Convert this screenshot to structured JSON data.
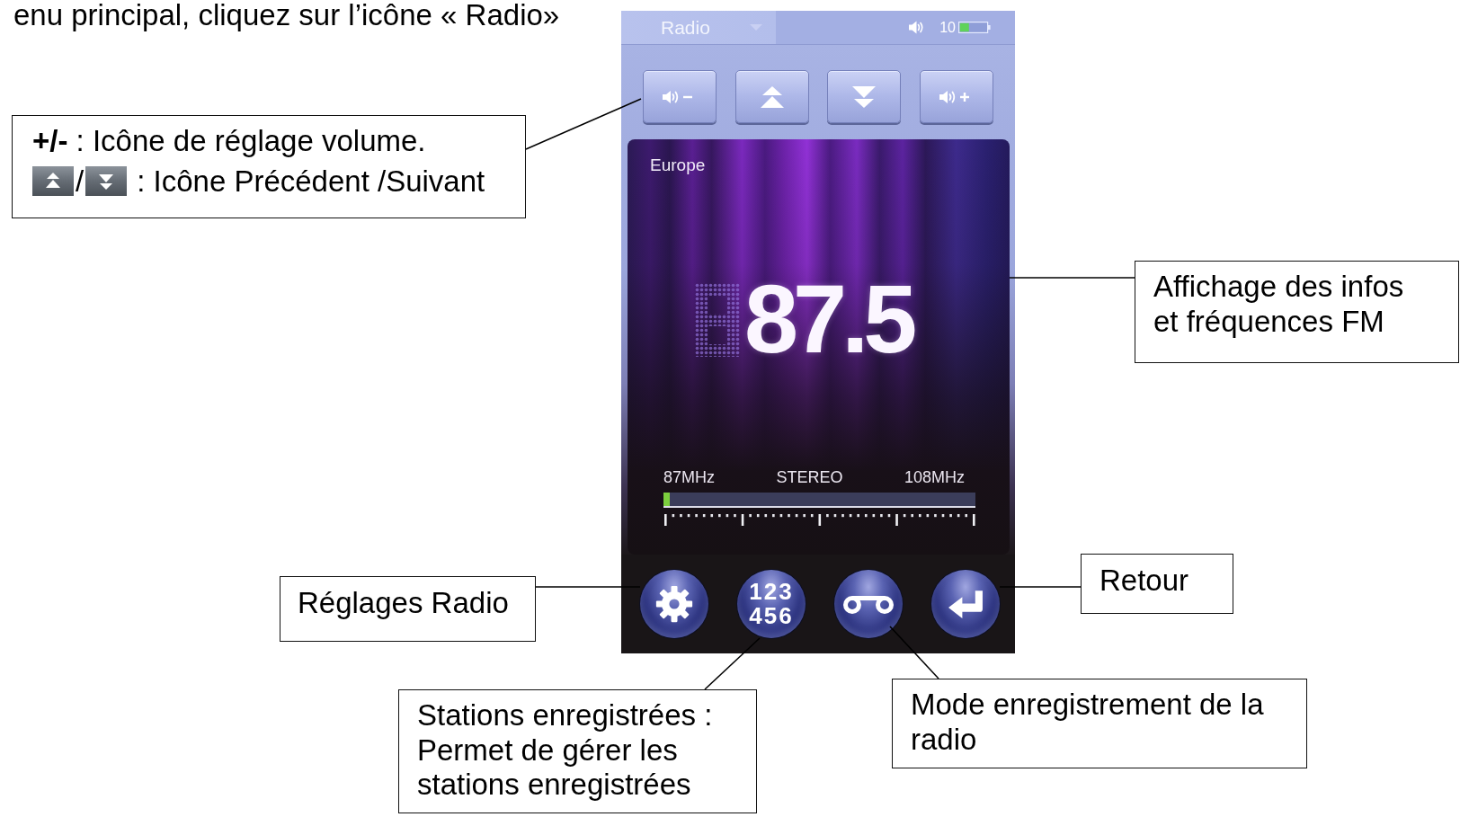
{
  "intro": "enu principal, cliquez sur l’icône « Radio»",
  "device": {
    "header": {
      "title": "Radio",
      "volume": "10"
    },
    "controls": [
      {
        "kind": "volume_down"
      },
      {
        "kind": "previous"
      },
      {
        "kind": "next"
      },
      {
        "kind": "volume_up"
      }
    ],
    "display": {
      "region": "Europe",
      "frequency": "87.5",
      "band_start": "87MHz",
      "mode": "STEREO",
      "band_end": "108MHz",
      "tuner": {
        "level": 0.02
      }
    },
    "buttons": [
      {
        "kind": "settings"
      },
      {
        "kind": "presets",
        "label": [
          "123",
          "456"
        ]
      },
      {
        "kind": "record"
      },
      {
        "kind": "back"
      }
    ]
  },
  "callouts": [
    {
      "kind": "legend",
      "text": "**+/-** : Icône de réglage volume.",
      "icons": [
        {
          "kind": "previous"
        },
        {
          "kind": "next"
        }
      ],
      "separator": "/",
      "caption": ": Icône Précédent /Suivant"
    },
    {
      "kind": "note",
      "lines": [
        "Affichage des infos",
        "et fréquences FM"
      ]
    },
    {
      "kind": "note",
      "lines": [
        "Retour"
      ]
    },
    {
      "kind": "note",
      "lines": [
        "Réglages Radio"
      ]
    },
    {
      "kind": "note",
      "lines": [
        "Stations enregistrées :",
        "Permet de gérer les",
        "stations enregistrées"
      ]
    },
    {
      "kind": "note",
      "lines": [
        "Mode enregistrement de la",
        "radio"
      ]
    }
  ]
}
